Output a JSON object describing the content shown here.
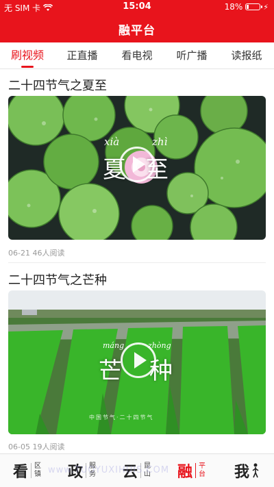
{
  "status_bar": {
    "carrier": "无 SIM 卡",
    "time": "15:04",
    "battery_text": "18%",
    "battery_level": 0.18
  },
  "app": {
    "title": "融平台"
  },
  "tabs": [
    {
      "label": "刷视频",
      "active": true
    },
    {
      "label": "正直播",
      "active": false
    },
    {
      "label": "看电视",
      "active": false
    },
    {
      "label": "听广播",
      "active": false
    },
    {
      "label": "读报纸",
      "active": false
    }
  ],
  "feed": [
    {
      "title": "二十四节气之夏至",
      "overlay_pinyin_1": "xià",
      "overlay_pinyin_2": "zhì",
      "overlay_char_1": "夏",
      "overlay_char_2": "至",
      "meta": "06-21 46人阅读"
    },
    {
      "title": "二十四节气之芒种",
      "overlay_pinyin_1": "máng",
      "overlay_pinyin_2": "zhòng",
      "overlay_char_1": "芒",
      "overlay_char_2": "种",
      "overlay_caption": "中国节气·二十四节气",
      "meta": "06-05 19人阅读"
    }
  ],
  "bottom_nav": [
    {
      "big": "看",
      "small": "区镇",
      "active": false
    },
    {
      "big": "政",
      "small": "服务",
      "active": false
    },
    {
      "big": "云",
      "small": "昆山",
      "active": false
    },
    {
      "big": "融",
      "small": "平台",
      "active": true
    },
    {
      "big": "我",
      "small": "",
      "active": false
    }
  ],
  "watermark": "www.TUOYUXIHUIS.COM",
  "colors": {
    "brand_red": "#e8141c",
    "lily_green": "#6bb64a",
    "field_green": "#3fae2c"
  }
}
